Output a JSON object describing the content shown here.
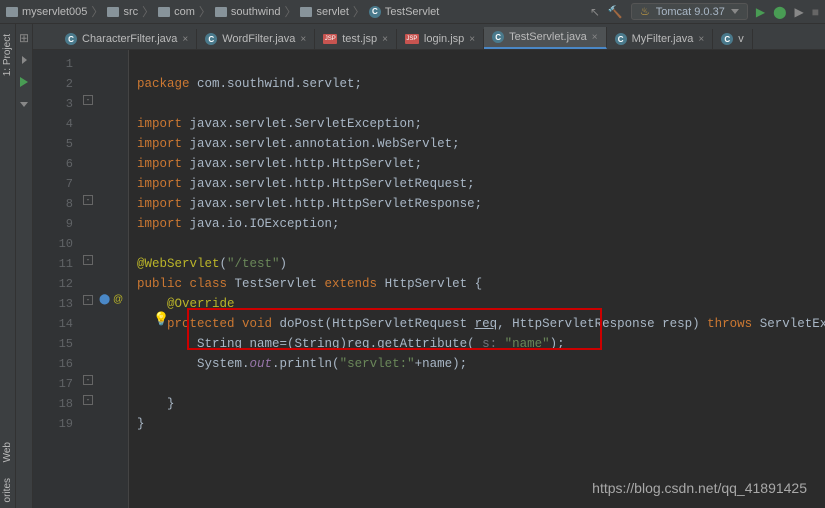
{
  "breadcrumb": {
    "items": [
      "myservlet005",
      "src",
      "com",
      "southwind",
      "servlet",
      "TestServlet"
    ]
  },
  "runConfig": {
    "label": "Tomcat 9.0.37"
  },
  "tabs": [
    {
      "label": "CharacterFilter.java",
      "type": "class",
      "active": false
    },
    {
      "label": "WordFilter.java",
      "type": "class",
      "active": false
    },
    {
      "label": "test.jsp",
      "type": "jsp",
      "active": false
    },
    {
      "label": "login.jsp",
      "type": "jsp",
      "active": false
    },
    {
      "label": "TestServlet.java",
      "type": "class",
      "active": true
    },
    {
      "label": "MyFilter.java",
      "type": "class",
      "active": false
    },
    {
      "label": "v",
      "type": "class",
      "active": false
    }
  ],
  "sideTabs": {
    "project": "1: Project",
    "web": "Web",
    "favorites": "orites"
  },
  "lineNumbers": [
    "1",
    "2",
    "3",
    "4",
    "5",
    "6",
    "7",
    "8",
    "9",
    "10",
    "11",
    "12",
    "13",
    "14",
    "15",
    "16",
    "17",
    "18",
    "19"
  ],
  "code": {
    "l1": {
      "kw": "package",
      "rest": " com.southwind.servlet;"
    },
    "l3": {
      "kw": "import",
      "rest": " javax.servlet.ServletException;"
    },
    "l4": {
      "kw": "import",
      "rest1": " javax.servlet.annotation.",
      "cls": "WebServlet",
      "rest2": ";"
    },
    "l5": {
      "kw": "import",
      "rest1": " javax.servlet.http.",
      "cls": "HttpServlet",
      "rest2": ";"
    },
    "l6": {
      "kw": "import",
      "rest1": " javax.servlet.http.",
      "cls": "HttpServletRequest",
      "rest2": ";"
    },
    "l7": {
      "kw": "import",
      "rest1": " javax.servlet.http.",
      "cls": "HttpServletResponse",
      "rest2": ";"
    },
    "l8": {
      "kw": "import",
      "rest": " java.io.IOException;"
    },
    "l10": {
      "ann": "@WebServlet",
      "paren": "(",
      "str": "\"/test\"",
      "close": ")"
    },
    "l11": {
      "kw1": "public class ",
      "cls": "TestServlet",
      "kw2": " extends ",
      "cls2": "HttpServlet",
      "brace": " {"
    },
    "l12": {
      "ann": "@Override"
    },
    "l13": {
      "kw1": "protected void ",
      "method": "doPost",
      "sig1": "(HttpServletRequest ",
      "p1": "req",
      "sig2": ", HttpServletResponse ",
      "p2": "resp",
      "sig3": ") ",
      "kw2": "throws ",
      "ex": "ServletException,"
    },
    "l14": {
      "t1": "String name=(String)",
      "p": "req",
      "t2": ".getAttribute( ",
      "hint": "s: ",
      "str": "\"name\"",
      "t3": ");"
    },
    "l15": {
      "t1": "System.",
      "field": "out",
      "t2": ".println(",
      "str": "\"servlet:\"",
      "t3": "+name);"
    },
    "l17_brace": "}",
    "l18_brace": "}"
  },
  "watermark": "https://blog.csdn.net/qq_41891425"
}
